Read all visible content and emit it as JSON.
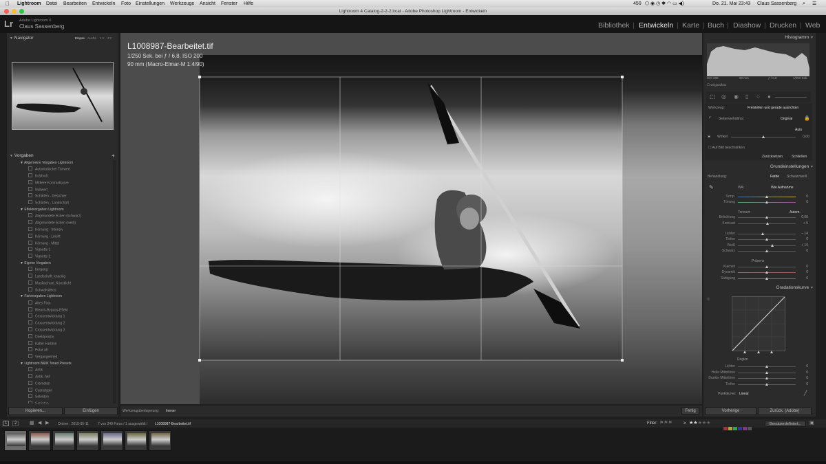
{
  "menubar": {
    "items": [
      "Lightroom",
      "Datei",
      "Bearbeiten",
      "Entwickeln",
      "Foto",
      "Einstellungen",
      "Werkzeuge",
      "Ansicht",
      "Fenster",
      "Hilfe"
    ],
    "status": "450",
    "clock": "Do. 21. Mai 23:43",
    "user": "Claus Sassenberg"
  },
  "window": {
    "title": "Lightroom 4 Catalog-2-2-2.lrcat - Adobe Photoshop Lightroom - Entwickeln"
  },
  "identity": {
    "logo": "Lr",
    "product": "Adobe Lightroom 6",
    "name": "Claus Sassenberg"
  },
  "modules": {
    "items": [
      "Bibliothek",
      "Entwickeln",
      "Karte",
      "Buch",
      "Diashow",
      "Drucken",
      "Web"
    ],
    "active": "Entwickeln"
  },
  "navigator": {
    "title": "Navigator",
    "zoom": [
      "Einpas.",
      "Ausfül.",
      "1:1",
      "2:1"
    ]
  },
  "presets": {
    "title": "Vorgaben",
    "add": "+",
    "tree": [
      {
        "t": "fold",
        "l": "Allgemeine Vorgaben Lightroom"
      },
      {
        "t": "pre",
        "l": "Automatischer Tonwert"
      },
      {
        "t": "pre",
        "l": "Kraftvoll"
      },
      {
        "t": "pre",
        "l": "Mittlere Kontrastkurve"
      },
      {
        "t": "pre",
        "l": "Nullwert"
      },
      {
        "t": "pre",
        "l": "Schärfen - Gesichter"
      },
      {
        "t": "pre",
        "l": "Schärfen - Landschaft"
      },
      {
        "t": "fold",
        "l": "Effektvorgaben Lightroom"
      },
      {
        "t": "pre",
        "l": "Abgerundete Ecken (schwarz)"
      },
      {
        "t": "pre",
        "l": "Abgerundete Ecken (weiß)"
      },
      {
        "t": "pre",
        "l": "Körnung - Intensiv"
      },
      {
        "t": "pre",
        "l": "Körnung - Leicht"
      },
      {
        "t": "pre",
        "l": "Körnung - Mittel"
      },
      {
        "t": "pre",
        "l": "Vignette 1"
      },
      {
        "t": "pre",
        "l": "Vignette 2"
      },
      {
        "t": "fold",
        "l": "Eigene Vorgaben"
      },
      {
        "t": "pre",
        "l": "bergung"
      },
      {
        "t": "pre",
        "l": "Landschaft_knackig"
      },
      {
        "t": "pre",
        "l": "Musikschule_Kunstlicht"
      },
      {
        "t": "pre",
        "l": "Schwalvideos"
      },
      {
        "t": "fold",
        "l": "Farbvorgaben Lightroom"
      },
      {
        "t": "pre",
        "l": "Altes Foto"
      },
      {
        "t": "pre",
        "l": "Bleach-Bypass-Effekt"
      },
      {
        "t": "pre",
        "l": "Crossentwicklung 1"
      },
      {
        "t": "pre",
        "l": "Crossentwicklung 2"
      },
      {
        "t": "pre",
        "l": "Crossentwicklung 3"
      },
      {
        "t": "pre",
        "l": "Direktpositiv"
      },
      {
        "t": "pre",
        "l": "Kalter Farbton"
      },
      {
        "t": "pre",
        "l": "Polar alt"
      },
      {
        "t": "pre",
        "l": "Vergangenheit"
      },
      {
        "t": "fold",
        "l": "Lightroom B&W Toned Presets"
      },
      {
        "t": "pre",
        "l": "Antik"
      },
      {
        "t": "pre",
        "l": "Antik, hell"
      },
      {
        "t": "pre",
        "l": "Cremeton"
      },
      {
        "t": "pre",
        "l": "Cyanotypie"
      },
      {
        "t": "pre",
        "l": "Selenton"
      },
      {
        "t": "pre",
        "l": "Sepiaton"
      },
      {
        "t": "pre",
        "l": "Teiltonung 1"
      }
    ]
  },
  "leftbuttons": {
    "copy": "Kopieren...",
    "paste": "Einfügen"
  },
  "image": {
    "filename": "L1008987-Bearbeitet.tif",
    "exposure": "1/250 Sek. bei ƒ / 6,8, ISO 200",
    "lens": "90 mm (Macro-Elmar-M 1:4/90)"
  },
  "toolbar": {
    "overlay_label": "Werkzeugüberlagerung:",
    "overlay_value": "Immer",
    "done": "Fertig"
  },
  "histogram": {
    "title": "Histogramm",
    "iso": "ISO 200",
    "focal": "90 mm",
    "aperture": "ƒ / 6,8",
    "shutter": "1/250 Sek.",
    "original": "Originalfoto"
  },
  "crop": {
    "tool_label": "Werkzeug:",
    "tool_name": "Freistellen und gerade ausrichten",
    "aspect_label": "Seitenverhältnis:",
    "aspect_value": "Original",
    "auto": "Auto",
    "angle_label": "Winkel",
    "angle_value": "0,00",
    "constrain": "Auf Bild beschränken",
    "reset": "Zurücksetzen",
    "close": "Schließen"
  },
  "basic": {
    "title": "Grundeinstellungen",
    "treatment_label": "Behandlung:",
    "color": "Farbe",
    "bw": "Schwarzweiß",
    "wb_label": "WA:",
    "wb_value": "Wie Aufnahme",
    "tone_label": "Tonwert",
    "tone_auto": "Autom.",
    "presence_label": "Präsenz",
    "sliders": [
      {
        "l": "Temp.",
        "v": "0",
        "p": 0.5,
        "g": "temp"
      },
      {
        "l": "Tönung",
        "v": "0",
        "p": 0.5,
        "g": "tint"
      },
      {
        "l": "Belichtung",
        "v": "0,00",
        "p": 0.5
      },
      {
        "l": "Kontrast",
        "v": "+ 5",
        "p": 0.52
      },
      {
        "l": "Lichter",
        "v": "– 14",
        "p": 0.43
      },
      {
        "l": "Tiefen",
        "v": "0",
        "p": 0.5
      },
      {
        "l": "Weiß",
        "v": "+ 19",
        "p": 0.6
      },
      {
        "l": "Schwarz",
        "v": "0",
        "p": 0.5
      },
      {
        "l": "Klarheit",
        "v": "0",
        "p": 0.5
      },
      {
        "l": "Dynamik",
        "v": "0",
        "p": 0.5
      },
      {
        "l": "Sättigung",
        "v": "0",
        "p": 0.5
      }
    ]
  },
  "curve": {
    "title": "Gradationskurve",
    "region": "Region",
    "sliders": [
      {
        "l": "Lichter",
        "v": "0"
      },
      {
        "l": "Helle Mitteltöne",
        "v": "0"
      },
      {
        "l": "Dunkle Mitteltöne",
        "v": "0"
      },
      {
        "l": "Tiefen",
        "v": "0"
      }
    ],
    "point_label": "Punktkurve:",
    "point_value": "Linear"
  },
  "rightbuttons": {
    "prev": "Vorherige",
    "reset": "Zurück. (Adobe)"
  },
  "filmbar": {
    "folder": "Ordner : 2015-05-11",
    "count": "7 von 249 Fotos / 1 ausgewählt /",
    "file": "L1008987-Bearbeitet.tif",
    "filter": "Filter:",
    "rating_op": "≥",
    "custom": "Benutzerdefiniert..."
  },
  "thumbs": [
    {
      "c": "#5a5a5a"
    },
    {
      "c": "#8a5a50"
    },
    {
      "c": "#6a7a70"
    },
    {
      "c": "#7a8060"
    },
    {
      "c": "#6a6a88"
    },
    {
      "c": "#6a6a40"
    },
    {
      "c": "#706848"
    }
  ],
  "colors": {
    "accent": "#d0d0d0",
    "panel": "#2b2b2b"
  }
}
